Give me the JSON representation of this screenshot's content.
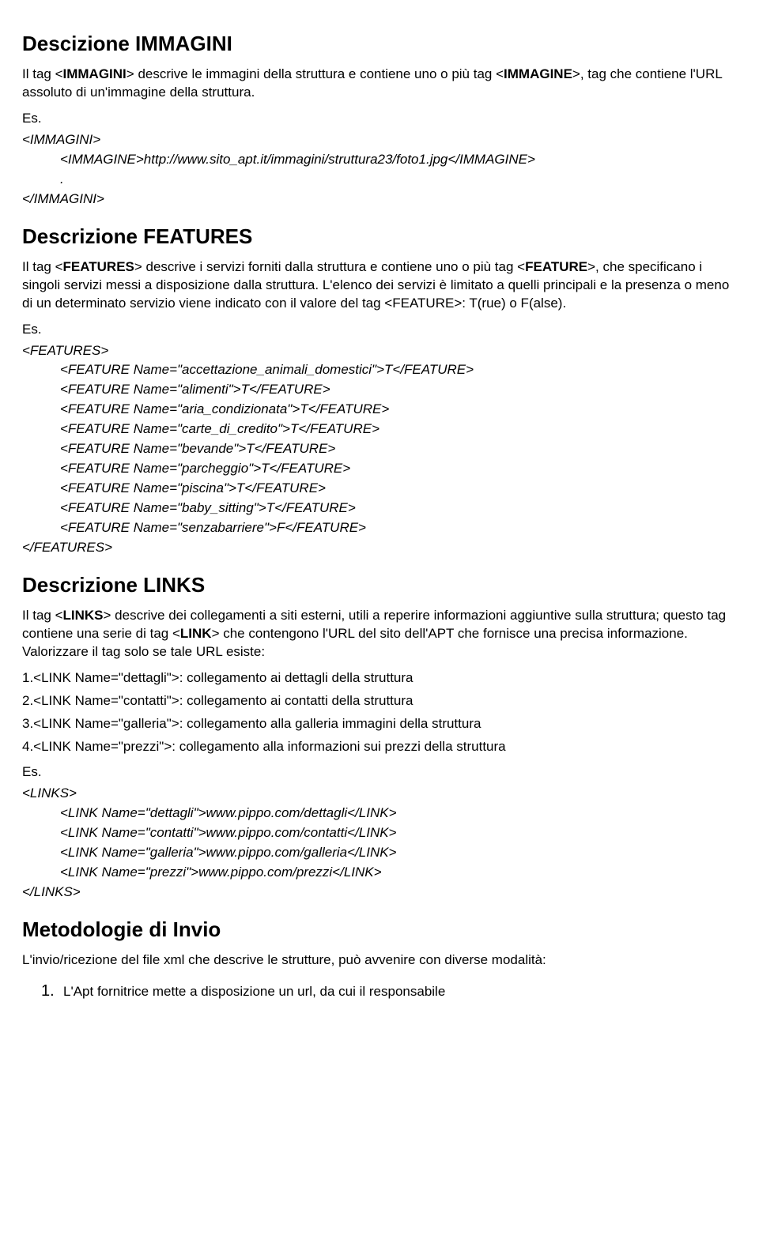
{
  "immagini": {
    "title": "Descizione IMMAGINI",
    "p1_a": "Il tag <",
    "p1_b": "IMMAGINI",
    "p1_c": "> descrive le immagini della struttura e contiene uno o più tag <",
    "p1_d": "IMMAGINE",
    "p1_e": ">, tag che contiene l'URL assoluto di un'immagine della struttura.",
    "es": "Es.",
    "ex_open": "<IMMAGINI>",
    "ex_line": "<IMMAGINE>http://www.sito_apt.it/immagini/struttura23/foto1.jpg</IMMAGINE>",
    "ex_dot": ".",
    "ex_close": "</IMMAGINI>"
  },
  "features": {
    "title": "Descrizione FEATURES",
    "p1_a": "Il tag <",
    "p1_b": "FEATURES",
    "p1_c": "> descrive i servizi forniti dalla struttura e contiene uno o più tag <",
    "p1_d": "FEATURE",
    "p1_e": ">, che specificano i singoli servizi messi a disposizione dalla struttura. L'elenco dei servizi è limitato a quelli principali e la presenza o meno di un determinato servizio viene indicato con il valore del tag <FEATURE>: T(rue) o F(alse).",
    "es": "Es.",
    "ex_open": "<FEATURES>",
    "ex_l1": "<FEATURE Name=\"accettazione_animali_domestici\">T</FEATURE>",
    "ex_l2": "<FEATURE Name=\"alimenti\">T</FEATURE>",
    "ex_l3": "<FEATURE Name=\"aria_condizionata\">T</FEATURE>",
    "ex_l4": "<FEATURE Name=\"carte_di_credito\">T</FEATURE>",
    "ex_l5": "<FEATURE Name=\"bevande\">T</FEATURE>",
    "ex_l6": "<FEATURE Name=\"parcheggio\">T</FEATURE>",
    "ex_l7": "<FEATURE Name=\"piscina\">T</FEATURE>",
    "ex_l8": "<FEATURE Name=\"baby_sitting\">T</FEATURE>",
    "ex_l9": "<FEATURE Name=\"senzabarriere\">F</FEATURE>",
    "ex_close": "</FEATURES>"
  },
  "links": {
    "title": "Descrizione LINKS",
    "p1_a": "Il tag <",
    "p1_b": "LINKS",
    "p1_c": "> descrive dei collegamenti a siti esterni, utili a reperire informazioni aggiuntive sulla struttura; questo tag contiene una serie di tag <",
    "p1_d": "LINK",
    "p1_e": "> che contengono l'URL del sito dell'APT che fornisce una precisa informazione. Valorizzare il tag solo se tale URL esiste:",
    "n1": "1.<LINK Name=\"dettagli\">: collegamento ai dettagli della struttura",
    "n2": "2.<LINK Name=\"contatti\">: collegamento ai contatti della struttura",
    "n3": "3.<LINK Name=\"galleria\">: collegamento alla galleria immagini della struttura",
    "n4": "4.<LINK Name=\"prezzi\">: collegamento alla informazioni sui prezzi della struttura",
    "es": "Es.",
    "ex_open": "<LINKS>",
    "ex_l1": "<LINK Name=\"dettagli\">www.pippo.com/dettagli</LINK>",
    "ex_l2": "<LINK Name=\"contatti\">www.pippo.com/contatti</LINK>",
    "ex_l3": "<LINK Name=\"galleria\">www.pippo.com/galleria</LINK>",
    "ex_l4": "<LINK Name=\"prezzi\">www.pippo.com/prezzi</LINK>",
    "ex_close": "</LINKS>"
  },
  "metodologie": {
    "title": "Metodologie di Invio",
    "p1": "L'invio/ricezione del file xml che descrive le strutture, può avvenire con diverse modalità:",
    "item1_num": "1.",
    "item1_text": "L'Apt fornitrice mette a disposizione un url, da cui il responsabile"
  }
}
